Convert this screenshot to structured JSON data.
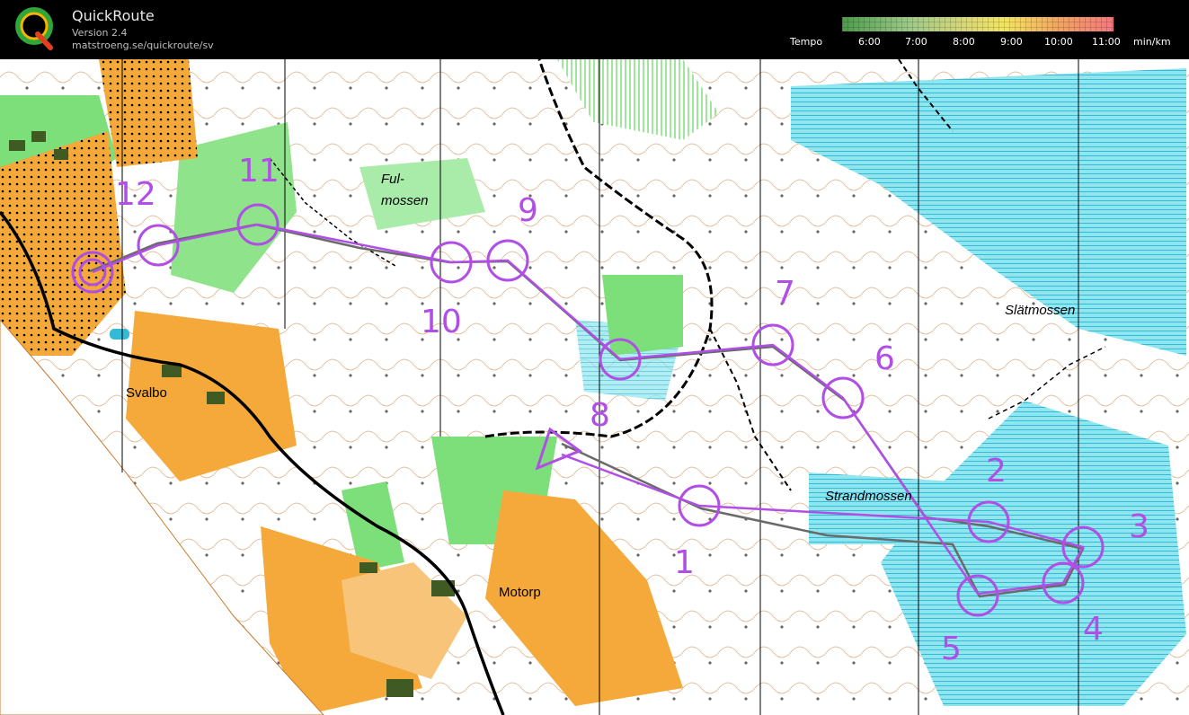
{
  "app": {
    "title": "QuickRoute",
    "version": "Version 2.4",
    "url": "matstroeng.se/quickroute/sv",
    "logo_icon": "quickroute-q-logo"
  },
  "legend": {
    "label": "Tempo",
    "ticks": [
      "6:00",
      "7:00",
      "8:00",
      "9:00",
      "10:00",
      "11:00"
    ],
    "unit": "min/km",
    "colors": [
      "#4e9a4c",
      "#9ec98a",
      "#d7d77a",
      "#f3e463",
      "#f0a463",
      "#f2787f"
    ]
  },
  "map": {
    "place_names": {
      "fulmossen_line1": "Ful-",
      "fulmossen_line2": "mossen",
      "slatmossen": "Slätmossen",
      "svalbo": "Svalbo",
      "strandmossen": "Strandmossen",
      "motorp": "Motorp"
    },
    "course_color": "#b04ee6",
    "controls": [
      {
        "number": "1"
      },
      {
        "number": "2"
      },
      {
        "number": "3"
      },
      {
        "number": "4"
      },
      {
        "number": "5"
      },
      {
        "number": "6"
      },
      {
        "number": "7"
      },
      {
        "number": "8"
      },
      {
        "number": "9"
      },
      {
        "number": "10"
      },
      {
        "number": "11"
      },
      {
        "number": "12"
      }
    ]
  }
}
